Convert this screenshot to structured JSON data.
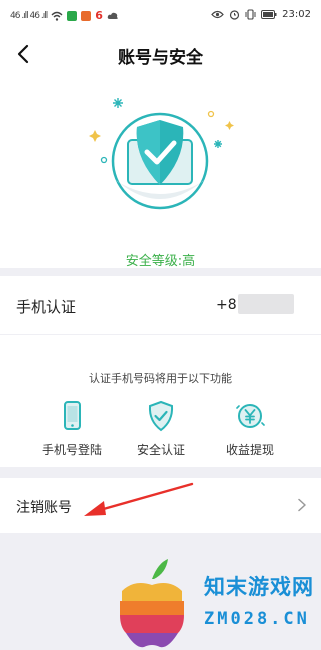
{
  "status_bar": {
    "signal_left": "46 .ıll 46 .ıll",
    "red_badge_text": "6",
    "time": "23:02",
    "icons": [
      "signal-icon",
      "wifi-icon",
      "app-badge-icon",
      "eye-icon",
      "alarm-icon",
      "vibrate-icon",
      "battery-icon"
    ]
  },
  "nav": {
    "title": "账号与安全",
    "back_icon": "chevron-left-icon"
  },
  "hero": {
    "security_level": "安全等级:高",
    "shield_color": "#2bb5b8",
    "level_color": "#3bb04a"
  },
  "phone_auth": {
    "label": "手机认证",
    "value": "+8"
  },
  "functions": {
    "hint": "认证手机号码将用于以下功能",
    "items": [
      {
        "label": "手机号登陆",
        "icon": "phone-icon"
      },
      {
        "label": "安全认证",
        "icon": "shield-check-icon"
      },
      {
        "label": "收益提现",
        "icon": "yen-coin-icon"
      }
    ]
  },
  "cancel_account": {
    "label": "注销账号",
    "icon": "chevron-right-icon"
  },
  "watermark": {
    "cn": "知末游戏网",
    "en": "ZM028.CN"
  }
}
